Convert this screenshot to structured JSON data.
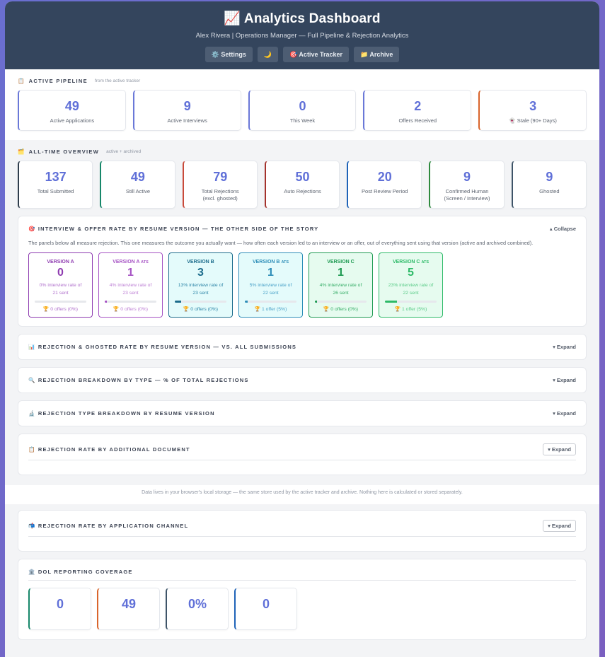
{
  "header": {
    "title": "📈 Analytics Dashboard",
    "subtitle": "Alex Rivera | Operations Manager — Full Pipeline & Rejection Analytics",
    "buttons": [
      {
        "label": "⚙️ Settings"
      },
      {
        "label": "🌙"
      },
      {
        "label": "🎯 Active Tracker"
      },
      {
        "label": "📁 Archive"
      }
    ]
  },
  "active_pipeline": {
    "icon": "📋",
    "title": "ACTIVE PIPELINE",
    "note": "from the active tracker",
    "stats": [
      {
        "value": "49",
        "label": "Active Applications",
        "color": "#6a78d8"
      },
      {
        "value": "9",
        "label": "Active Interviews",
        "color": "#6a78d8"
      },
      {
        "value": "0",
        "label": "This Week",
        "color": "#6a78d8"
      },
      {
        "value": "2",
        "label": "Offers Received",
        "color": "#6a78d8"
      },
      {
        "value": "3",
        "label": "👻 Stale (90+ Days)",
        "color": "#d9642b"
      }
    ]
  },
  "all_time": {
    "icon": "🗂️",
    "title": "ALL-TIME OVERVIEW",
    "note": "active + archived",
    "stats": [
      {
        "value": "137",
        "label": "Total Submitted",
        "color": "#2f3d4c"
      },
      {
        "value": "49",
        "label": "Still Active",
        "color": "#17876a"
      },
      {
        "value": "79",
        "label": "Total Rejections",
        "label2": "(excl. ghosted)",
        "color": "#c94a3a"
      },
      {
        "value": "50",
        "label": "Auto Rejections",
        "color": "#a4322c"
      },
      {
        "value": "20",
        "label": "Post Review Period",
        "color": "#1e63b8"
      },
      {
        "value": "9",
        "label": "Confirmed Human",
        "label2": "(Screen / Interview)",
        "color": "#2e8a3e"
      },
      {
        "value": "9",
        "label": "Ghosted",
        "color": "#3e5468"
      }
    ]
  },
  "interview_section": {
    "title": "🎯 INTERVIEW & OFFER RATE BY RESUME VERSION — THE OTHER SIDE OF THE STORY",
    "toggle": "▴ Collapse",
    "description": "The panels below all measure rejection. This one measures the outcome you actually want — how often each version led to an interview or an offer, out of everything sent using that version (active and archived combined).",
    "versions": [
      {
        "name": "VERSION A",
        "ats": "",
        "value": "0",
        "rate": "0% interview rate of",
        "sent": "21 sent",
        "offers": "🏆 0 offers (0%)",
        "pct": 0,
        "color": "#8e3bb0",
        "light": "#b071cc",
        "bg": "#ffffff",
        "bar": "#8e3bb0"
      },
      {
        "name": "VERSION A",
        "ats": "ATS",
        "value": "1",
        "rate": "4% interview rate of",
        "sent": "23 sent",
        "offers": "🏆 0 offers (0%)",
        "pct": 0.04,
        "color": "#a653c4",
        "light": "#bd7fd4",
        "bg": "#ffffff",
        "bar": "#a653c4"
      },
      {
        "name": "VERSION B",
        "ats": "",
        "value": "3",
        "rate": "13% interview rate of",
        "sent": "23 sent",
        "offers": "🏆 0 offers (0%)",
        "pct": 0.13,
        "color": "#1c6c8c",
        "light": "#2f86a8",
        "bg": "#e4fbfb",
        "bar": "#1c6c8c"
      },
      {
        "name": "VERSION B",
        "ats": "ATS",
        "value": "1",
        "rate": "5% interview rate of",
        "sent": "22 sent",
        "offers": "🏆 1 offer (5%)",
        "pct": 0.05,
        "color": "#2e8eb8",
        "light": "#4aa2c8",
        "bg": "#e4fbfb",
        "bar": "#2e8eb8"
      },
      {
        "name": "VERSION C",
        "ats": "",
        "value": "1",
        "rate": "4% interview rate of",
        "sent": "26 sent",
        "offers": "🏆 0 offers (0%)",
        "pct": 0.04,
        "color": "#1e9a52",
        "light": "#36ad67",
        "bg": "#e6fbef",
        "bar": "#1e9a52"
      },
      {
        "name": "VERSION C",
        "ats": "ATS",
        "value": "5",
        "rate": "23% interview rate of",
        "sent": "22 sent",
        "offers": "🏆 1 offer (5%)",
        "pct": 0.23,
        "color": "#2dba68",
        "light": "#5acb88",
        "bg": "#e6fbef",
        "bar": "#2dba68"
      }
    ]
  },
  "collapsed_sections": [
    {
      "title": "📊 REJECTION & GHOSTED RATE BY RESUME VERSION — VS. ALL SUBMISSIONS",
      "toggle": "▾ Expand"
    },
    {
      "title": "🔍 REJECTION BREAKDOWN BY TYPE — % OF TOTAL REJECTIONS",
      "toggle": "▾ Expand"
    },
    {
      "title": "🔬 REJECTION TYPE BREAKDOWN BY RESUME VERSION",
      "toggle": "▾ Expand"
    }
  ],
  "doc_section": {
    "title": "📋 REJECTION RATE BY ADDITIONAL DOCUMENT",
    "toggle": "▾ Expand"
  },
  "footer_note": "Data lives in your browser's local storage — the same store used by the active tracker and archive. Nothing here is calculated or stored separately.",
  "channel_section": {
    "title": "📬 REJECTION RATE BY APPLICATION CHANNEL",
    "toggle": "▾ Expand"
  },
  "dol_section": {
    "title": "🏛️ DOL REPORTING COVERAGE",
    "stats": [
      {
        "value": "0",
        "color": "#17876a"
      },
      {
        "value": "49",
        "color": "#d9642b"
      },
      {
        "value": "0%",
        "color": "#3e5468"
      },
      {
        "value": "0",
        "color": "#1e63b8"
      }
    ]
  }
}
